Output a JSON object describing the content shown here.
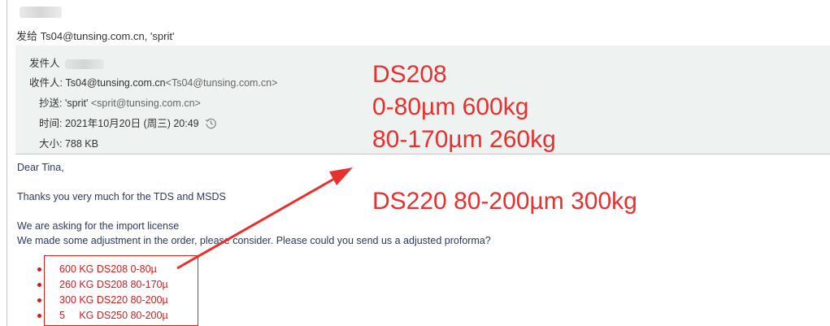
{
  "header": {
    "sendto_line": "发给 Ts04@tunsing.com.cn, 'sprit'"
  },
  "meta": {
    "from_label": "发件人",
    "to_label": "收件人:",
    "to_name": "Ts04@tunsing.com.cn",
    "to_addr": "<Ts04@tunsing.com.cn>",
    "cc_label": "抄送:",
    "cc_name": "'sprit'",
    "cc_addr": "<sprit@tunsing.com.cn>",
    "time_label": "时间:",
    "time_value": "2021年10月20日 (周三) 20:49",
    "size_label": "大小:",
    "size_value": "788 KB"
  },
  "body": {
    "greeting": "Dear Tina,",
    "thanks": "Thanks you very much for the TDS and MSDS",
    "line1": "We are asking for the import license",
    "line2": "We made some adjustment in the order, please consider. Please could you send us a adjusted proforma?",
    "order_items": [
      "600 KG DS208 0-80µ",
      "260 KG DS208 80-170µ",
      "300 KG DS220 80-200µ",
      "5     KG DS250 80-200µ"
    ]
  },
  "annotations": {
    "lines": [
      "DS208",
      "0-80µm 600kg",
      "80-170µm 260kg",
      "DS220 80-200µm 300kg"
    ],
    "color": "#e8302e"
  },
  "icons": {
    "time": "history-clock-icon"
  },
  "colors": {
    "panel_bg": "#eef2f1",
    "highlight_red": "#d01c1c"
  }
}
